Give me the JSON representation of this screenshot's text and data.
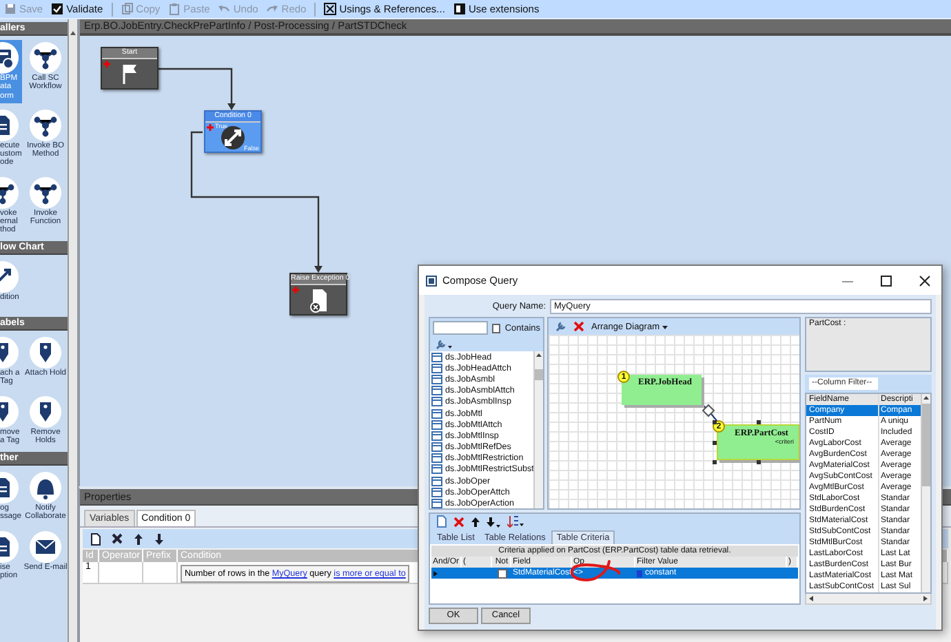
{
  "toolbar": {
    "buttons": [
      {
        "label": "Save",
        "disabled": true
      },
      {
        "label": "Validate",
        "disabled": false
      },
      {
        "label": "Copy",
        "disabled": true
      },
      {
        "label": "Paste",
        "disabled": true
      },
      {
        "label": "Undo",
        "disabled": true
      },
      {
        "label": "Redo",
        "disabled": true
      },
      {
        "label": "Usings & References...",
        "disabled": false
      },
      {
        "label": "Use extensions",
        "disabled": false
      }
    ]
  },
  "palette": {
    "sections": [
      {
        "title": "allers",
        "items": [
          {
            "label": "BPM ata orm",
            "selected": true
          },
          {
            "label": "Call SC Workflow",
            "selected": false
          },
          {
            "label": "ecute ustom ode",
            "selected": false
          },
          {
            "label": "Invoke BO Method",
            "selected": false
          },
          {
            "label": "voke ernal thod",
            "selected": false
          },
          {
            "label": "Invoke Function",
            "selected": false
          }
        ]
      },
      {
        "title": "low Chart",
        "items": [
          {
            "label": "dition",
            "selected": false
          }
        ]
      },
      {
        "title": "abels",
        "items": [
          {
            "label": "ach a Tag",
            "selected": false
          },
          {
            "label": "Attach Hold",
            "selected": false
          },
          {
            "label": "move a Tag",
            "selected": false
          },
          {
            "label": "Remove Holds",
            "selected": false
          }
        ]
      },
      {
        "title": "ther",
        "items": [
          {
            "label": "og ssage",
            "selected": false
          },
          {
            "label": "Notify Collaborate",
            "selected": false
          },
          {
            "label": "ise ption",
            "selected": false
          },
          {
            "label": "Send E-mail",
            "selected": false
          }
        ]
      }
    ]
  },
  "canvas": {
    "path": "Erp.BO.JobEntry.CheckPrePartInfo / Post-Processing / PartSTDCheck",
    "nodes": [
      {
        "kind": "start",
        "title": "Start",
        "selected": false
      },
      {
        "kind": "condition",
        "title": "Condition 0",
        "true_label": "True",
        "false_label": "False",
        "selected": true
      },
      {
        "kind": "exception",
        "title": "Raise Exception 0",
        "selected": false
      }
    ]
  },
  "properties": {
    "title": "Properties",
    "tabs": [
      {
        "label": "Variables",
        "selected": false
      },
      {
        "label": "Condition 0",
        "selected": true
      }
    ],
    "columns": [
      "Id",
      "Operator",
      "Prefix",
      "Condition"
    ],
    "rows": [
      {
        "id": "1",
        "condition": [
          {
            "kind": "text",
            "text": "Number of rows in the "
          },
          {
            "kind": "link",
            "text": "MyQuery"
          },
          {
            "kind": "text",
            "text": " query "
          },
          {
            "kind": "link",
            "text": "is more or equal to"
          }
        ]
      }
    ]
  },
  "dialog": {
    "title": "Compose Query",
    "query_name_label": "Query Name:",
    "query_name": "MyQuery",
    "contains_label": "Contains",
    "contains_checked": false,
    "tables": [
      "ds.JobHead",
      "ds.JobHeadAttch",
      "ds.JobAsmbl",
      "ds.JobAsmblAttch",
      "ds.JobAsmblInsp",
      "ds.JobMtl",
      "ds.JobMtlAttch",
      "ds.JobMtlInsp",
      "ds.JobMtlRefDes",
      "ds.JobMtlRestriction",
      "ds.JobMtlRestrictSubst",
      "ds.JobOper",
      "ds.JobOperAttch",
      "ds.JobOperAction"
    ],
    "arrange_label": "Arrange Diagram",
    "diagram_nodes": [
      {
        "number": "1",
        "name": "ERP.JobHead",
        "selected": false
      },
      {
        "number": "2",
        "name": "ERP.PartCost",
        "note": "<criteri",
        "selected": true
      }
    ],
    "fields_title": "PartCost :",
    "column_filter": "--Column Filter--",
    "field_columns": [
      "FieldName",
      "Descripti"
    ],
    "fields": [
      {
        "name": "Company",
        "description": "Compan",
        "selected": true
      },
      {
        "name": "PartNum",
        "description": "A uniqu",
        "selected": false
      },
      {
        "name": "CostID",
        "description": "Included",
        "selected": false
      },
      {
        "name": "AvgLaborCost",
        "description": "Average",
        "selected": false
      },
      {
        "name": "AvgBurdenCost",
        "description": "Average",
        "selected": false
      },
      {
        "name": "AvgMaterialCost",
        "description": "Average",
        "selected": false
      },
      {
        "name": "AvgSubContCost",
        "description": "Average",
        "selected": false
      },
      {
        "name": "AvgMtlBurCost",
        "description": "Average",
        "selected": false
      },
      {
        "name": "StdLaborCost",
        "description": "Standar",
        "selected": false
      },
      {
        "name": "StdBurdenCost",
        "description": "Standar",
        "selected": false
      },
      {
        "name": "StdMaterialCost",
        "description": "Standar",
        "selected": false
      },
      {
        "name": "StdSubContCost",
        "description": "Standar",
        "selected": false
      },
      {
        "name": "StdMtlBurCost",
        "description": "Standar",
        "selected": false
      },
      {
        "name": "LastLaborCost",
        "description": "Last Lat",
        "selected": false
      },
      {
        "name": "LastBurdenCost",
        "description": "Last Bur",
        "selected": false
      },
      {
        "name": "LastMaterialCost",
        "description": "Last Mat",
        "selected": false
      },
      {
        "name": "LastSubContCost",
        "description": "Last Sul",
        "selected": false
      }
    ],
    "bottom_tabs": [
      {
        "label": "Table List",
        "selected": false
      },
      {
        "label": "Table Relations",
        "selected": false
      },
      {
        "label": "Table Criteria",
        "selected": true
      }
    ],
    "criteria_caption": "Criteria applied on PartCost (ERP.PartCost)  table data retrieval.",
    "criteria_columns": [
      "And/Or",
      "(",
      "Not",
      "Field",
      "Op",
      "Filter Value",
      ")"
    ],
    "criteria_rows": [
      {
        "field": "StdMaterialCost",
        "operation": "<>",
        "filter_value": "constant",
        "not": false,
        "selected": true
      }
    ],
    "buttons": [
      "OK",
      "Cancel"
    ]
  }
}
